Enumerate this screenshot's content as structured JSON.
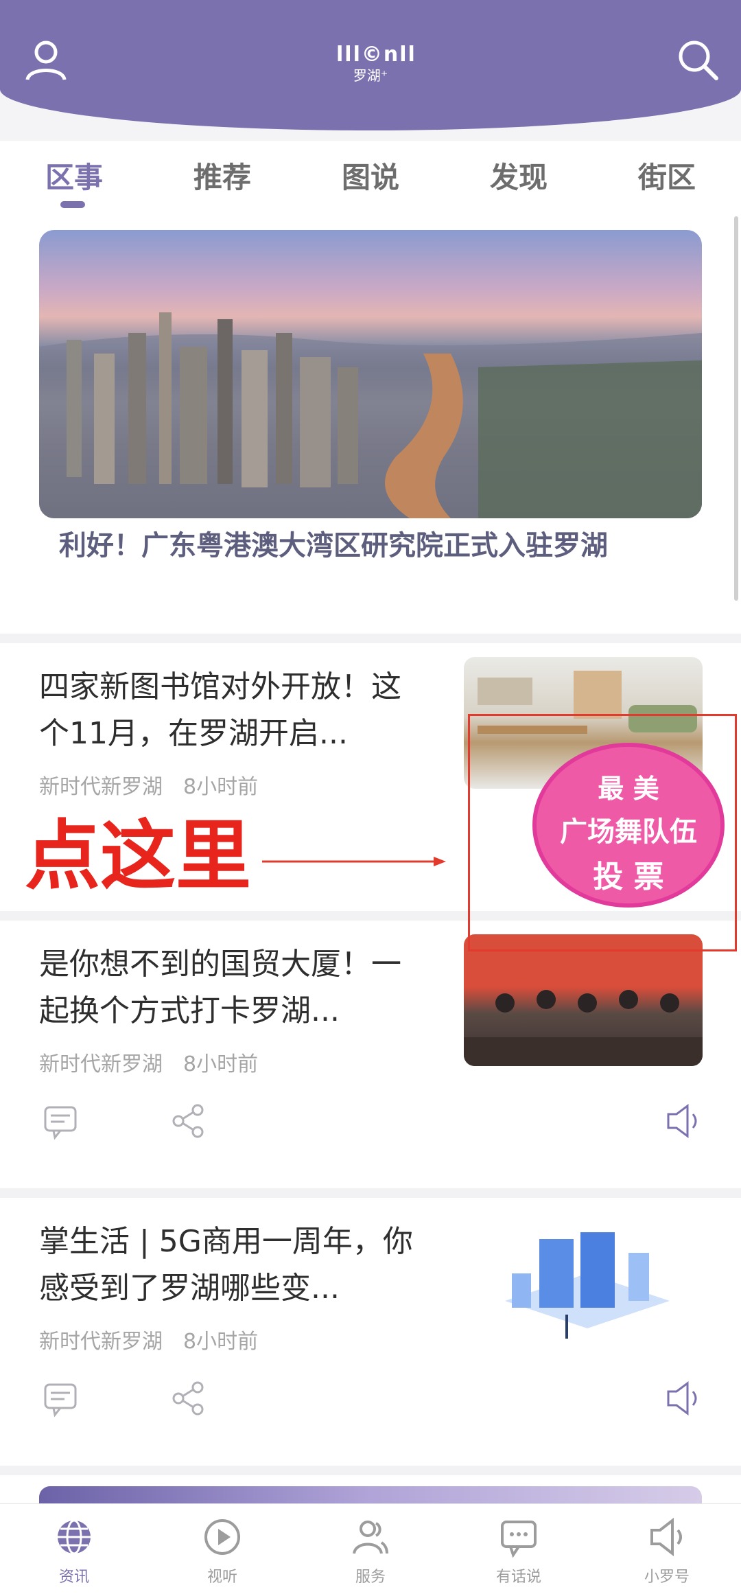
{
  "header": {
    "logo_mark": "lll©nll",
    "logo_sub": "罗湖⁺",
    "profile_icon": "user-icon",
    "search_icon": "search-icon"
  },
  "tabs": [
    {
      "label": "区事",
      "active": true
    },
    {
      "label": "推荐",
      "active": false
    },
    {
      "label": "图说",
      "active": false
    },
    {
      "label": "发现",
      "active": false
    },
    {
      "label": "街区",
      "active": false
    }
  ],
  "hero": {
    "title": "利好！广东粤港澳大湾区研究院正式入驻罗湖"
  },
  "articles": [
    {
      "title": "四家新图书馆对外开放！这个11月，在罗湖开启...",
      "source": "新时代新罗湖",
      "time": "8小时前"
    },
    {
      "title": "是你想不到的国贸大厦！一起换个方式打卡罗湖...",
      "source": "新时代新罗湖",
      "time": "8小时前"
    },
    {
      "title": "掌生活 | 5G商用一周年，你感受到了罗湖哪些变...",
      "source": "新时代新罗湖",
      "time": "8小时前"
    }
  ],
  "annotation": {
    "text": "点这里"
  },
  "vote_badge": {
    "line1": "最 美",
    "line2": "广场舞队伍",
    "line3": "投 票"
  },
  "bottom_nav": [
    {
      "label": "资讯",
      "icon": "globe-icon",
      "active": true
    },
    {
      "label": "视听",
      "icon": "play-icon",
      "active": false
    },
    {
      "label": "服务",
      "icon": "people-icon",
      "active": false
    },
    {
      "label": "有话说",
      "icon": "chat-icon",
      "active": false
    },
    {
      "label": "小罗号",
      "icon": "speaker-icon",
      "active": false
    }
  ],
  "colors": {
    "brand": "#7b71ae",
    "annotation": "#e8251c",
    "badge": "#ef5aa7"
  }
}
